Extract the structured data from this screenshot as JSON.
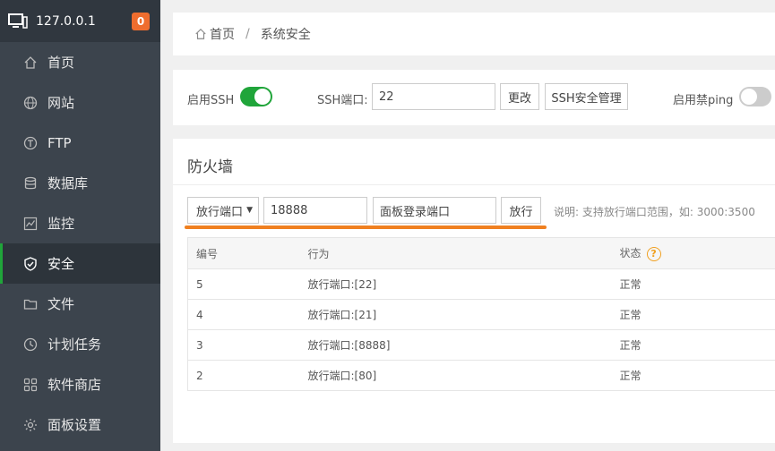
{
  "sidebar": {
    "host": "127.0.0.1",
    "badge": "0",
    "items": [
      {
        "label": "首页",
        "icon": "home-icon"
      },
      {
        "label": "网站",
        "icon": "globe-icon"
      },
      {
        "label": "FTP",
        "icon": "ftp-icon"
      },
      {
        "label": "数据库",
        "icon": "database-icon"
      },
      {
        "label": "监控",
        "icon": "monitor-chart-icon"
      },
      {
        "label": "安全",
        "icon": "shield-icon"
      },
      {
        "label": "文件",
        "icon": "folder-icon"
      },
      {
        "label": "计划任务",
        "icon": "clock-icon"
      },
      {
        "label": "软件商店",
        "icon": "grid-icon"
      },
      {
        "label": "面板设置",
        "icon": "gear-icon"
      }
    ],
    "active_index": 5
  },
  "breadcrumb": {
    "home": "首页",
    "separator": "/",
    "current": "系统安全"
  },
  "ssh": {
    "enable_label": "启用SSH",
    "enabled": true,
    "port_label": "SSH端口:",
    "port_value": "22",
    "change_btn": "更改",
    "manage_btn": "SSH安全管理",
    "ping_label": "启用禁ping",
    "ping_enabled": false
  },
  "firewall": {
    "title": "防火墙",
    "select_value": "放行端口",
    "port_input": "18888",
    "remark_input": "面板登录端口",
    "submit_btn": "放行",
    "hint": "说明: 支持放行端口范围，如: 3000:3500",
    "columns": [
      "编号",
      "行为",
      "状态"
    ],
    "rows": [
      {
        "id": "5",
        "action": "放行端口:[22]",
        "status": "正常"
      },
      {
        "id": "4",
        "action": "放行端口:[21]",
        "status": "正常"
      },
      {
        "id": "3",
        "action": "放行端口:[8888]",
        "status": "正常"
      },
      {
        "id": "2",
        "action": "放行端口:[80]",
        "status": "正常"
      }
    ]
  },
  "colors": {
    "accent_green": "#20a53a",
    "badge_orange": "#ef6d2e",
    "highlight_orange": "#f08020",
    "sidebar_bg": "#3c444d"
  }
}
